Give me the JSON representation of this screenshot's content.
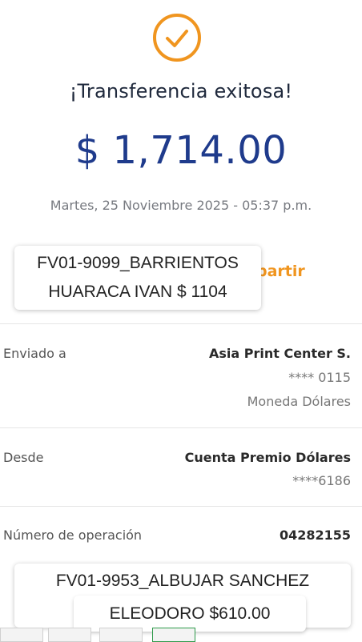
{
  "status_icon": "check-circle-icon",
  "accent_color": "#f0951f",
  "amount_color": "#1f3b8c",
  "title": "¡Transferencia exitosa!",
  "amount": "$ 1,714.00",
  "datetime": "Martes, 25 Noviembre 2025 - 05:37 p.m.",
  "share_label": "partir",
  "details": {
    "sent_to": {
      "label": "Enviado a",
      "name": "Asia Print Center S.",
      "account": "**** 0115",
      "currency": "Moneda Dólares"
    },
    "from": {
      "label": "Desde",
      "account_name": "Cuenta Premio Dólares",
      "account": "****6186"
    },
    "operation": {
      "label": "Número de operación",
      "number": "04282155"
    }
  },
  "overlay_labels": {
    "top_line1": "FV01-9099_BARRIENTOS",
    "top_line2": "HUARACA IVAN $ 1104",
    "bottom_line1": "FV01-9953_ALBUJAR SANCHEZ",
    "bottom_line2": "ELEODORO $610.00"
  }
}
